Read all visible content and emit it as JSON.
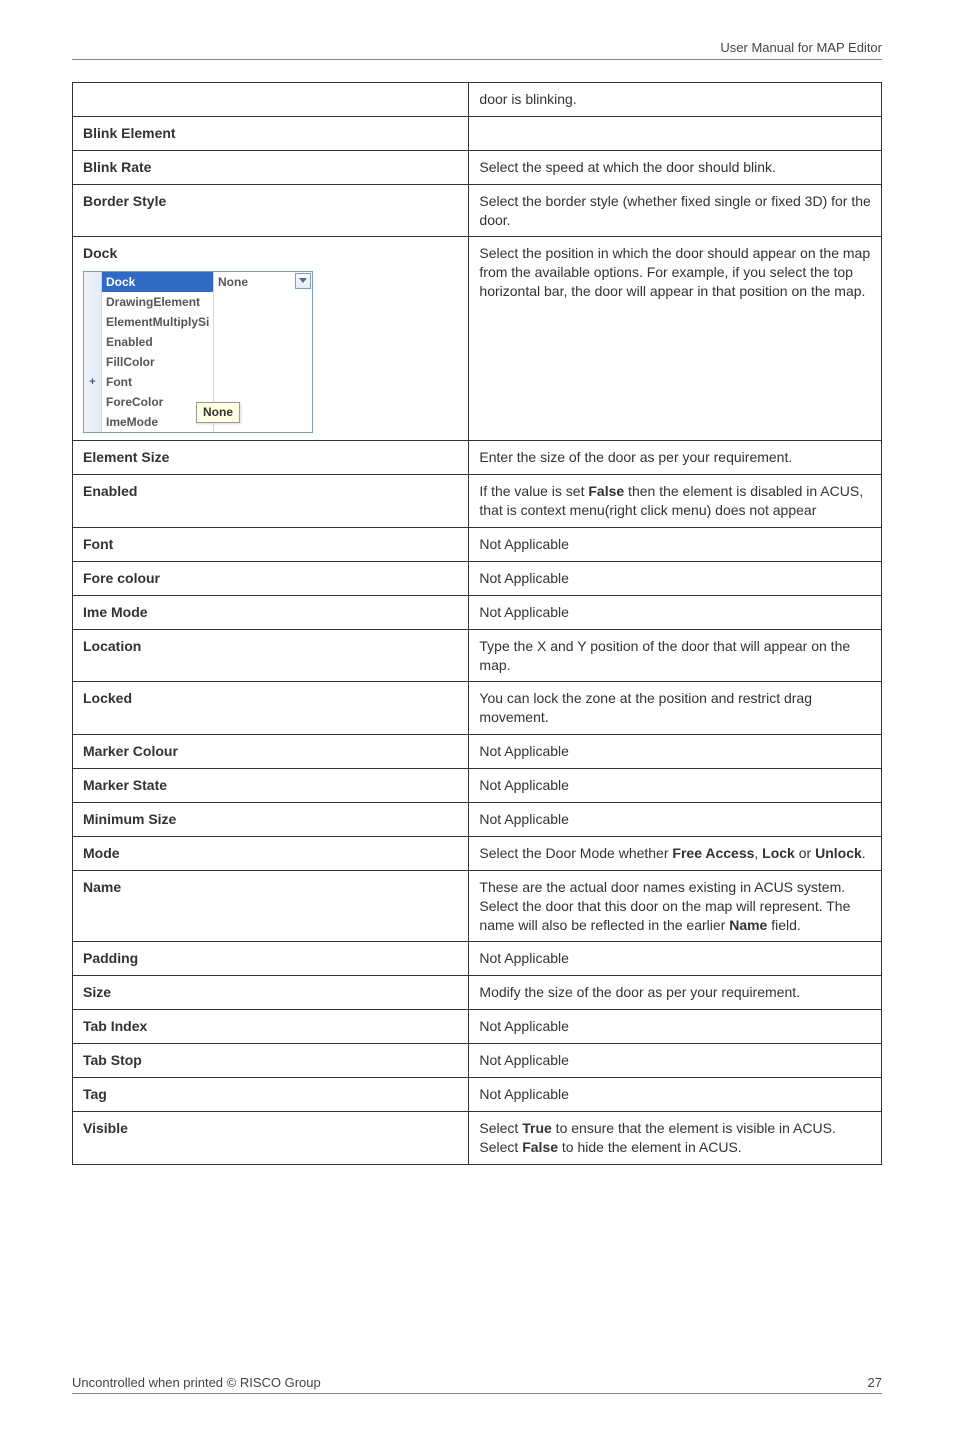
{
  "header": {
    "title": "User Manual for MAP Editor"
  },
  "footer": {
    "left": "Uncontrolled when printed © RISCO Group",
    "right": "27"
  },
  "propgrid": {
    "rows": [
      {
        "name": "Dock",
        "value": "None",
        "selected": true,
        "dropdown": true,
        "expander": ""
      },
      {
        "name": "DrawingElement",
        "value": "",
        "expander": ""
      },
      {
        "name": "ElementMultiplySi",
        "value": "",
        "expander": ""
      },
      {
        "name": "Enabled",
        "value": "",
        "expander": ""
      },
      {
        "name": "FillColor",
        "value": "",
        "expander": ""
      },
      {
        "name": "Font",
        "value": "",
        "expander": "+"
      },
      {
        "name": "ForeColor",
        "value": "",
        "expander": ""
      },
      {
        "name": "ImeMode",
        "value": "",
        "expander": ""
      }
    ],
    "tooltip": "None"
  },
  "rows": [
    {
      "label": "",
      "desc": "door is blinking."
    },
    {
      "label": "Blink Element",
      "desc": ""
    },
    {
      "label": "Blink Rate",
      "desc": "Select the speed at which the door should blink."
    },
    {
      "label": "Border Style",
      "desc": "Select the border style (whether fixed single or fixed 3D) for the door."
    },
    {
      "label": "Dock",
      "desc": "Select the position in which the door should appear on the map from the available options. For example, if you select the top horizontal bar, the door will appear in that position on the map.",
      "dock": true
    },
    {
      "label": "Element Size",
      "desc": "Enter the size of the door as per your requirement."
    },
    {
      "label": "Enabled",
      "desc_html": "If the value is set <b>False</b> then the element is disabled in ACUS, that is context menu(right click menu) does not appear"
    },
    {
      "label": "Font",
      "desc": "Not Applicable"
    },
    {
      "label": "Fore colour",
      "desc": "Not Applicable"
    },
    {
      "label": "Ime Mode",
      "desc": "Not Applicable"
    },
    {
      "label": "Location",
      "desc": "Type the X and Y position of the door that will appear on the map."
    },
    {
      "label": "Locked",
      "desc": "You can lock the zone at the position and restrict drag movement."
    },
    {
      "label": "Marker Colour",
      "desc": "Not Applicable"
    },
    {
      "label": "Marker State",
      "desc": "Not Applicable"
    },
    {
      "label": "Minimum Size",
      "desc": "Not Applicable"
    },
    {
      "label": "Mode",
      "desc_html": "Select the Door Mode whether <b>Free Access</b>, <b>Lock</b> or <b>Unlock</b>."
    },
    {
      "label": "Name",
      "desc_html": "These are the actual door names existing in ACUS system. Select the door that this door on the map will represent. The name will also be reflected in the earlier <b>Name</b> field."
    },
    {
      "label": "Padding",
      "desc": "Not Applicable"
    },
    {
      "label": "Size",
      "desc": "Modify the size of the door as per your requirement."
    },
    {
      "label": "Tab Index",
      "desc": "Not Applicable"
    },
    {
      "label": "Tab Stop",
      "desc": "Not Applicable"
    },
    {
      "label": "Tag",
      "desc": "Not Applicable"
    },
    {
      "label": "Visible",
      "desc_html": "Select <b>True</b> to ensure that the element is visible in ACUS. Select <b>False</b> to hide the element in ACUS."
    }
  ]
}
